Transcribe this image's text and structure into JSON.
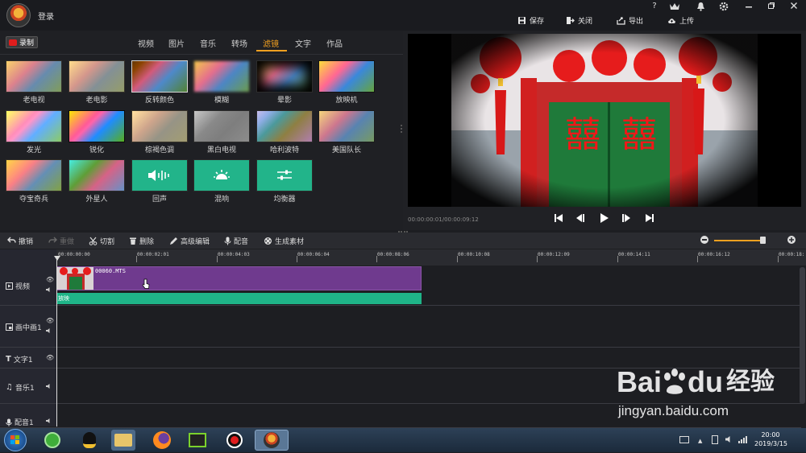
{
  "app": {
    "login_label": "登录"
  },
  "window_controls": [
    "?",
    "VIP",
    "bell",
    "gear",
    "min",
    "restore",
    "close"
  ],
  "actions": {
    "save": "保存",
    "close": "关闭",
    "export": "导出",
    "upload": "上传"
  },
  "record_label": "录制",
  "tabs": [
    {
      "label": "视频"
    },
    {
      "label": "图片"
    },
    {
      "label": "音乐"
    },
    {
      "label": "转场"
    },
    {
      "label": "滤镜",
      "active": true
    },
    {
      "label": "文字"
    },
    {
      "label": "作品"
    }
  ],
  "filters": [
    {
      "label": "老电视"
    },
    {
      "label": "老电影"
    },
    {
      "label": "反转颜色"
    },
    {
      "label": "模糊"
    },
    {
      "label": "晕影"
    },
    {
      "label": "放映机"
    },
    {
      "label": "发光"
    },
    {
      "label": "锐化"
    },
    {
      "label": "棕褐色调"
    },
    {
      "label": "黑白电视"
    },
    {
      "label": "哈利波特"
    },
    {
      "label": "美国队长"
    },
    {
      "label": "夺宝奇兵"
    },
    {
      "label": "外星人"
    },
    {
      "label": "回声"
    },
    {
      "label": "混响"
    },
    {
      "label": "均衡器"
    }
  ],
  "preview": {
    "timecode": "00:00:00:01/00:00:09:12",
    "door_text": "囍"
  },
  "toolbar": {
    "undo": "撤销",
    "redo": "重做",
    "cut": "切割",
    "delete": "删除",
    "advanced": "高级编辑",
    "dub": "配音",
    "generate": "生成素材"
  },
  "ruler_ticks": [
    "00:00:00:00",
    "00:00:02:01",
    "00:00:04:03",
    "00:00:06:04",
    "00:00:08:06",
    "00:00:10:08",
    "00:00:12:09",
    "00:00:14:11",
    "00:00:16:12",
    "00:00:18:"
  ],
  "tracks": [
    {
      "label": "视频"
    },
    {
      "label": "画中画1"
    },
    {
      "label": "文字1"
    },
    {
      "label": "音乐1"
    },
    {
      "label": "配音1"
    }
  ],
  "clip": {
    "name": "00060.MTS",
    "filter_label": "放映"
  },
  "clock": {
    "time": "20:00",
    "date": "2019/3/15"
  },
  "watermark": {
    "brand": "Bai",
    "brand2": "du",
    "cn": "经验",
    "url": "jingyan.baidu.com"
  },
  "colors": {
    "accent": "#f2a020",
    "clip": "#6f3a8e",
    "filter": "#1fb488",
    "record": "#e01d1d"
  }
}
